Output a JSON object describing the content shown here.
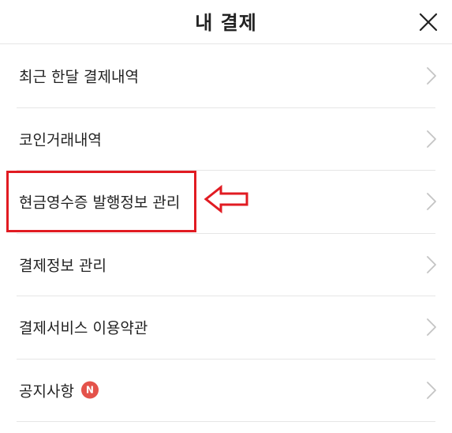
{
  "header": {
    "title": "내 결제",
    "close_icon": "close-icon"
  },
  "menu": {
    "items": [
      {
        "label": "최근 한달 결제내역",
        "icon": "chevron-right-icon"
      },
      {
        "label": "코인거래내역",
        "icon": "chevron-right-icon"
      },
      {
        "label": "현금영수증 발행정보 관리",
        "icon": "chevron-right-icon",
        "highlighted": true
      },
      {
        "label": "결제정보 관리",
        "icon": "chevron-right-icon"
      },
      {
        "label": "결제서비스 이용약관",
        "icon": "chevron-right-icon"
      },
      {
        "label": "공지사항",
        "icon": "chevron-right-icon",
        "badge": "N"
      }
    ]
  },
  "colors": {
    "annotation": "#e11b22",
    "badge": "#e4524a",
    "divider": "#e6e6e6",
    "chevron": "#c4c4c4"
  }
}
